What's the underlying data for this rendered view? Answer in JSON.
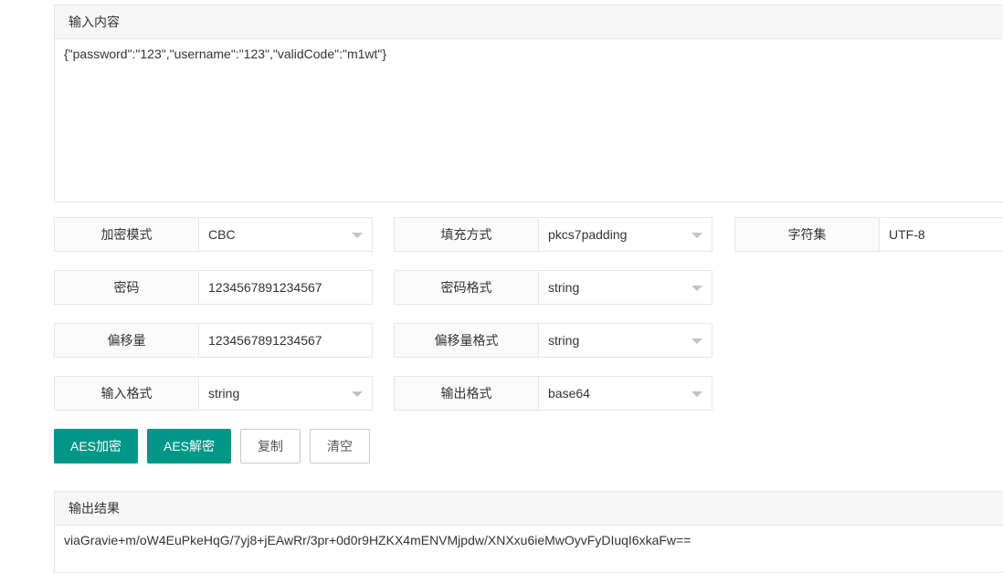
{
  "input_panel": {
    "title": "输入内容",
    "value": "{\"password\":\"123\",\"username\":\"123\",\"validCode\":\"m1wt\"}"
  },
  "fields": {
    "mode": {
      "label": "加密模式",
      "value": "CBC"
    },
    "padding": {
      "label": "填充方式",
      "value": "pkcs7padding"
    },
    "charset": {
      "label": "字符集",
      "value": "UTF-8"
    },
    "key": {
      "label": "密码",
      "value": "1234567891234567"
    },
    "key_format": {
      "label": "密码格式",
      "value": "string"
    },
    "iv": {
      "label": "偏移量",
      "value": "1234567891234567"
    },
    "iv_format": {
      "label": "偏移量格式",
      "value": "string"
    },
    "input_format": {
      "label": "输入格式",
      "value": "string"
    },
    "output_format": {
      "label": "输出格式",
      "value": "base64"
    }
  },
  "buttons": {
    "encrypt": "AES加密",
    "decrypt": "AES解密",
    "copy": "复制",
    "clear": "清空"
  },
  "output_panel": {
    "title": "输出结果",
    "value": "viaGravie+m/oW4EuPkeHqG/7yj8+jEAwRr/3pr+0d0r9HZKX4mENVMjpdw/XNXxu6ieMwOyvFyDIuqI6xkaFw=="
  },
  "colors": {
    "primary": "#009688",
    "border": "#e6e6e6",
    "header_bg": "#f7f7f7"
  }
}
